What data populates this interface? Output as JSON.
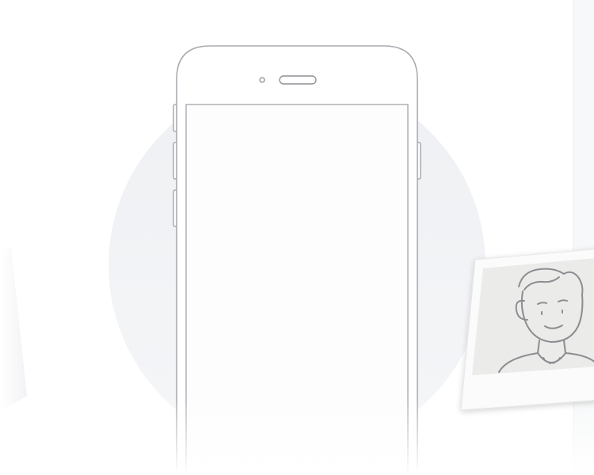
{
  "colors": {
    "background": "#ffffff",
    "backdrop_circle": "#eef0f3",
    "phone_body": "#ffffff",
    "phone_outline": "#a9abb0",
    "screen_fill": "#fdfdfd",
    "photo_frame": "#fbfbfb",
    "photo_inner": "#ebebea",
    "portrait_line": "#8c8d90"
  },
  "illustration": {
    "subject": "phone-outline-with-polaroid-portrait",
    "icons": [
      "phone-icon",
      "earpiece-icon",
      "camera-dot-icon",
      "portrait-icon"
    ]
  }
}
